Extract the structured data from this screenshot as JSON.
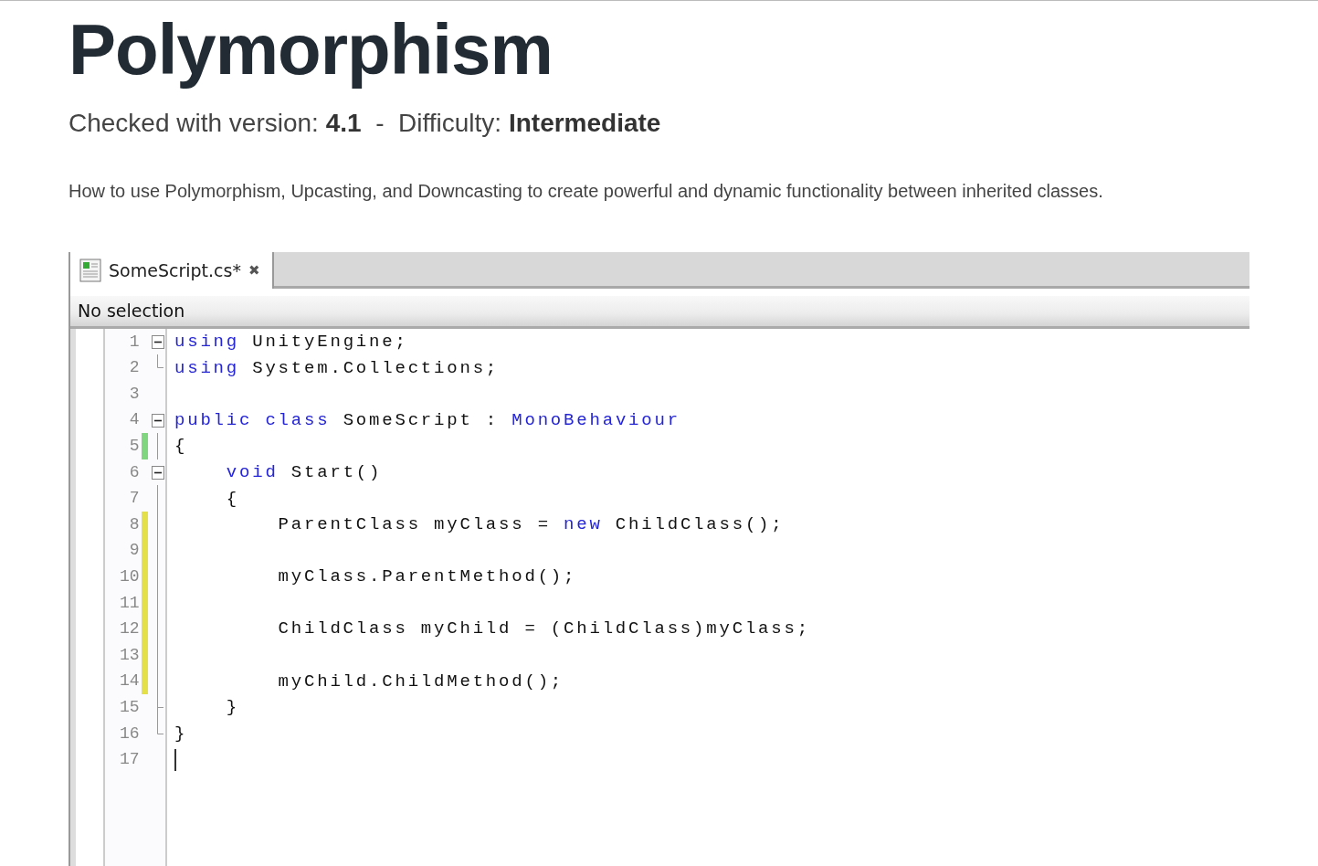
{
  "title": "Polymorphism",
  "meta": "Checked with version: **4.1**  -  Difficulty: **Intermediate**",
  "description": "How to use Polymorphism, Upcasting, and Downcasting to create powerful and dynamic functionality between inherited classes.",
  "editor": {
    "tab": {
      "label": "SomeScript.cs*",
      "close": "✖",
      "selected": true
    },
    "status": "No selection",
    "lines": [
      {
        "number": "1",
        "fold_mark": {
          "kind": "toggle"
        },
        "tokens": [
          {
            "kind": "keyword",
            "text": "using"
          },
          {
            "kind": "plain",
            "text": " UnityEngine;"
          }
        ]
      },
      {
        "number": "2",
        "fold_mark": {
          "kind": "end"
        },
        "tokens": [
          {
            "kind": "keyword",
            "text": "using"
          },
          {
            "kind": "plain",
            "text": " System.Collections;"
          }
        ]
      },
      {
        "number": "3"
      },
      {
        "number": "4",
        "fold_mark": {
          "kind": "toggle"
        },
        "tokens": [
          {
            "kind": "keyword",
            "text": "public class"
          },
          {
            "kind": "plain",
            "text": " SomeScript : "
          },
          {
            "kind": "keyword",
            "text": "MonoBehaviour"
          }
        ]
      },
      {
        "number": "5",
        "fold_mark": {
          "kind": "guide"
        },
        "change": {
          "color": "#7fd67f"
        },
        "tokens": [
          {
            "kind": "plain",
            "text": "{"
          }
        ]
      },
      {
        "number": "6",
        "fold_mark": {
          "kind": "toggle"
        },
        "tokens": [
          {
            "kind": "keyword",
            "text": "    void"
          },
          {
            "kind": "plain",
            "text": " Start()"
          }
        ]
      },
      {
        "number": "7",
        "fold_mark": {
          "kind": "guide"
        },
        "tokens": [
          {
            "kind": "plain",
            "text": "    {"
          }
        ]
      },
      {
        "number": "8",
        "fold_mark": {
          "kind": "guide"
        },
        "change": {
          "color": "#e4e04a"
        },
        "tokens": [
          {
            "kind": "plain",
            "text": "        ParentClass myClass = "
          },
          {
            "kind": "keyword",
            "text": "new"
          },
          {
            "kind": "plain",
            "text": " ChildClass();"
          }
        ]
      },
      {
        "number": "9",
        "fold_mark": {
          "kind": "guide"
        },
        "change": {
          "color": "#e4e04a"
        }
      },
      {
        "number": "10",
        "fold_mark": {
          "kind": "guide"
        },
        "change": {
          "color": "#e4e04a"
        },
        "tokens": [
          {
            "kind": "plain",
            "text": "        myClass.ParentMethod();"
          }
        ]
      },
      {
        "number": "11",
        "fold_mark": {
          "kind": "guide"
        },
        "change": {
          "color": "#e4e04a"
        }
      },
      {
        "number": "12",
        "fold_mark": {
          "kind": "guide"
        },
        "change": {
          "color": "#e4e04a"
        },
        "tokens": [
          {
            "kind": "plain",
            "text": "        ChildClass myChild = (ChildClass)myClass;"
          }
        ]
      },
      {
        "number": "13",
        "fold_mark": {
          "kind": "guide"
        },
        "change": {
          "color": "#e4e04a"
        }
      },
      {
        "number": "14",
        "fold_mark": {
          "kind": "guide"
        },
        "change": {
          "color": "#e4e04a"
        },
        "tokens": [
          {
            "kind": "plain",
            "text": "        myChild.ChildMethod();"
          }
        ]
      },
      {
        "number": "15",
        "fold_mark": {
          "kind": "branch"
        },
        "tokens": [
          {
            "kind": "plain",
            "text": "    }"
          }
        ]
      },
      {
        "number": "16",
        "fold_mark": {
          "kind": "end"
        },
        "tokens": [
          {
            "kind": "plain",
            "text": "}"
          }
        ]
      },
      {
        "number": "17",
        "cursor": true
      }
    ]
  }
}
